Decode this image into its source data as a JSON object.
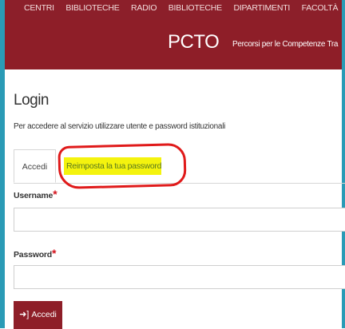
{
  "topnav": {
    "items": [
      "CENTRI",
      "BIBLIOTECHE",
      "RADIO",
      "BIBLIOTECHE",
      "DIPARTIMENTI",
      "FACOLTÀ"
    ]
  },
  "header": {
    "title": "PCTO",
    "subtitle": "Percorsi per le Competenze Tra"
  },
  "login": {
    "heading": "Login",
    "intro": "Per accedere al servizio utilizzare utente e password istituzionali",
    "tabs": {
      "accedi": "Accedi",
      "reset": "Reimposta la tua password"
    },
    "username_label": "Username",
    "password_label": "Password",
    "required_mark": "*",
    "submit_label": "Accedi"
  },
  "colors": {
    "brand": "#8e1e28",
    "frame": "#2a9bb6",
    "highlight": "#f4f30e",
    "annotation": "#e01a1a"
  },
  "icons": {
    "submit": "sign-in-icon"
  }
}
